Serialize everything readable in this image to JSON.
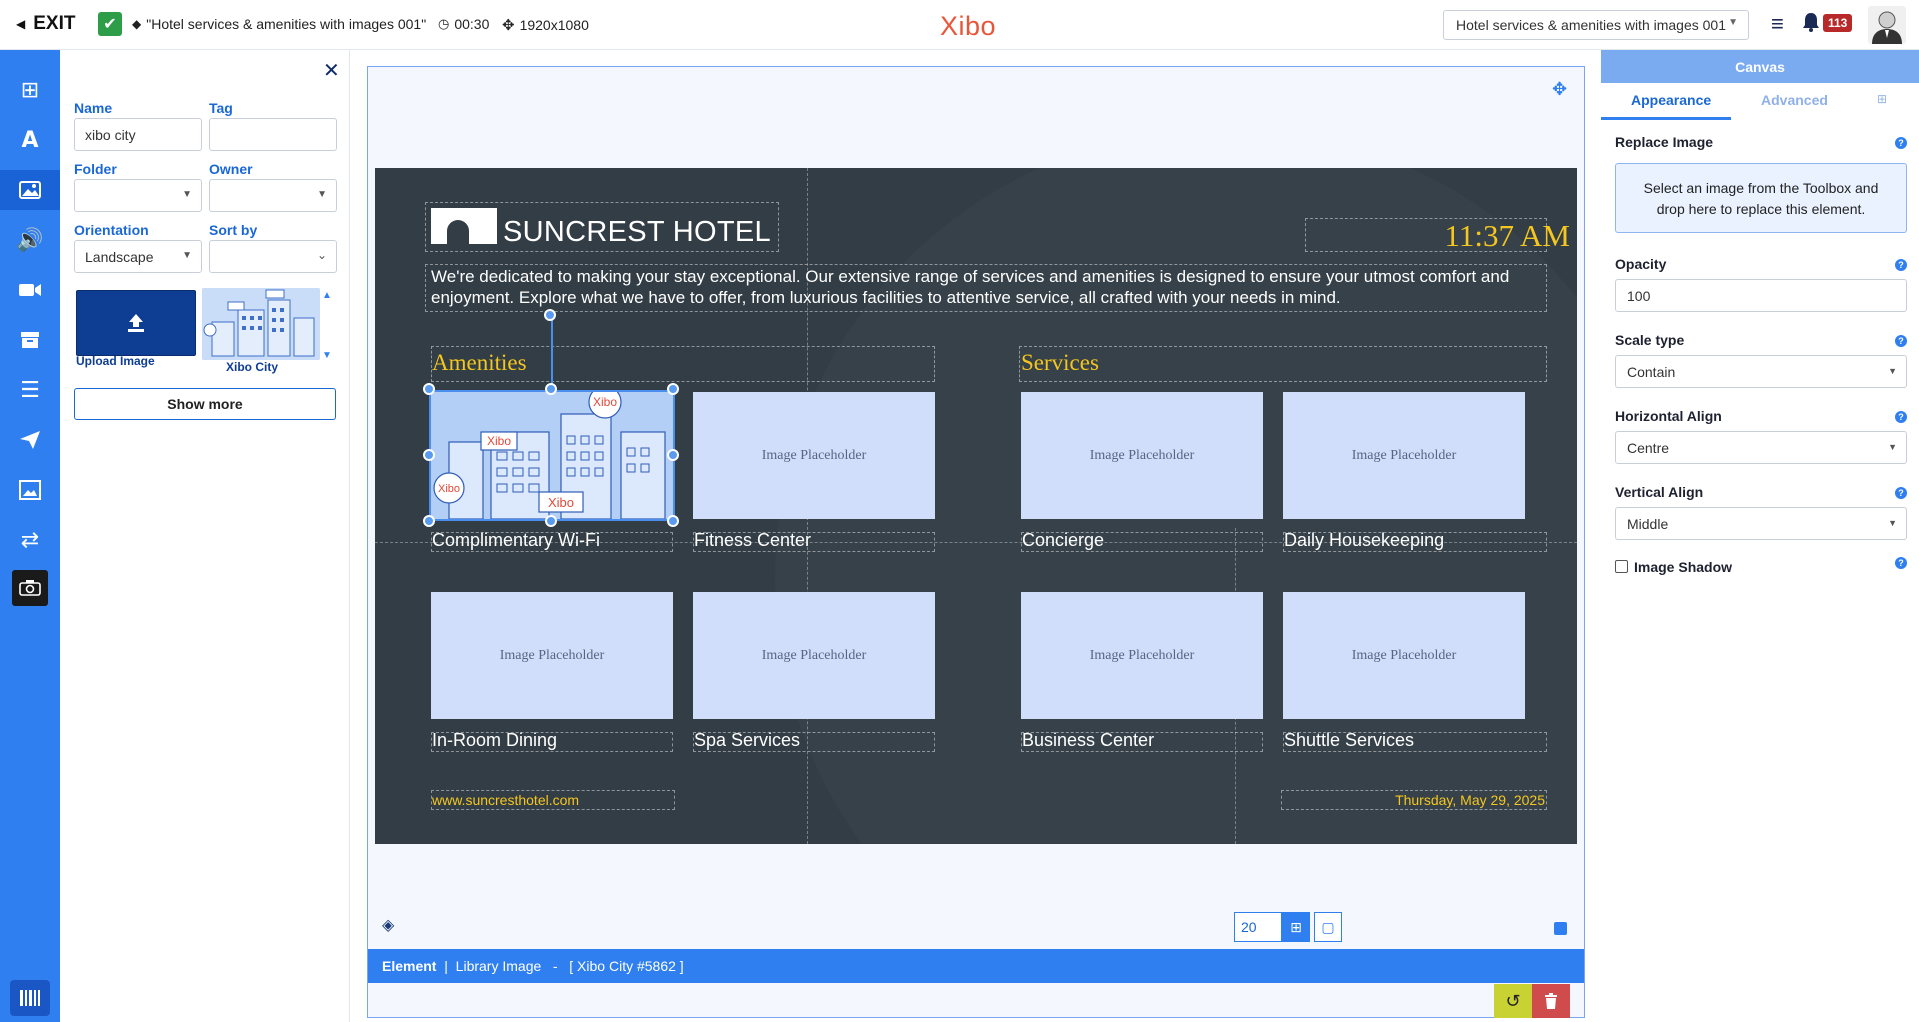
{
  "topbar": {
    "exit_label": "EXIT",
    "layout_name": "\"Hotel services & amenities with images 001\"",
    "duration": "00:30",
    "resolution": "1920x1080",
    "logo_text": "Xibo",
    "layout_select_value": "Hotel services & amenities with images 001",
    "notification_count": "113"
  },
  "toolbox": {
    "name_label": "Name",
    "name_value": "xibo city",
    "tag_label": "Tag",
    "tag_value": "",
    "folder_label": "Folder",
    "owner_label": "Owner",
    "orientation_label": "Orientation",
    "orientation_value": "Landscape",
    "sortby_label": "Sort by",
    "upload_label": "Upload Image",
    "thumb_label": "Xibo City",
    "show_more_label": "Show more"
  },
  "canvas": {
    "hotel_name": "SUNCREST HOTEL",
    "clock": "11:37 AM",
    "intro": "We're dedicated to making your stay exceptional. Our extensive range of services and amenities is designed to ensure your utmost comfort and enjoyment. Explore what we have to offer, from luxurious facilities to attentive service, all crafted with your needs in mind.",
    "amenities_title": "Amenities",
    "services_title": "Services",
    "placeholder_text": "Image Placeholder",
    "tiles": [
      {
        "label": "Complimentary Wi-Fi"
      },
      {
        "label": "Fitness Center"
      },
      {
        "label": "Concierge"
      },
      {
        "label": "Daily Housekeeping"
      },
      {
        "label": "In-Room Dining"
      },
      {
        "label": "Spa Services"
      },
      {
        "label": "Business Center"
      },
      {
        "label": "Shuttle Services"
      }
    ],
    "image_badge": "Xibo",
    "website": "www.suncresthotel.com",
    "date": "Thursday, May 29, 2025"
  },
  "editor": {
    "zoom_value": "20",
    "status_element": "Element",
    "status_type": "Library Image",
    "status_media": "[ Xibo City #5862 ]"
  },
  "props": {
    "header": "Canvas",
    "tab_appearance": "Appearance",
    "tab_advanced": "Advanced",
    "replace_label": "Replace Image",
    "replace_hint": "Select an image from the Toolbox and drop here to replace this element.",
    "opacity_label": "Opacity",
    "opacity_value": "100",
    "scale_label": "Scale type",
    "scale_value": "Contain",
    "halign_label": "Horizontal Align",
    "halign_value": "Centre",
    "valign_label": "Vertical Align",
    "valign_value": "Middle",
    "shadow_label": "Image Shadow"
  },
  "colors": {
    "accent": "#2f7ff0",
    "canvas_bg": "#323d45",
    "gold": "#f4c61f",
    "placeholder": "#d0defc"
  }
}
